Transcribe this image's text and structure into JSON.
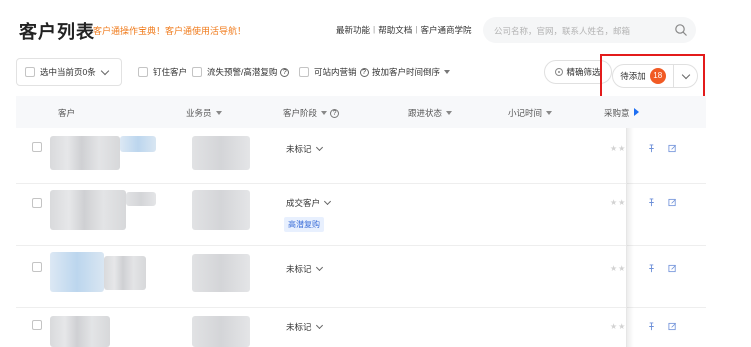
{
  "header": {
    "title": "客户列表",
    "promo": "客户通操作宝典！客户通使用活导航！",
    "links": [
      "最新功能",
      "帮助文档",
      "客户通商学院"
    ],
    "search_placeholder": "公司名称，官网，联系人姓名，邮箱"
  },
  "toolbar": {
    "select_page": "选中当前页0条",
    "pin_customer": "钉住客户",
    "churn_warning": "流失预警/高潜复购",
    "site_marketing": "可站内营销",
    "sort": "按加客户时间倒序",
    "precise_filter": "精确筛选",
    "pending_add": "待添加",
    "pending_count": "18"
  },
  "table": {
    "columns": {
      "customer": "客户",
      "salesperson": "业务员",
      "stage": "客户阶段",
      "follow_status": "跟进状态",
      "note_time": "小记时间",
      "purchase": "采购意"
    },
    "rows": [
      {
        "stage": "未标记",
        "tag": ""
      },
      {
        "stage": "成交客户",
        "tag": "高潜复购"
      },
      {
        "stage": "未标记",
        "tag": ""
      },
      {
        "stage": "未标记",
        "tag": ""
      }
    ],
    "star_glyph": "★★"
  },
  "colors": {
    "accent_orange": "#f07b1c",
    "badge": "#f15a24",
    "highlight_border": "#e31b1b",
    "link_blue": "#1d6ef2"
  }
}
